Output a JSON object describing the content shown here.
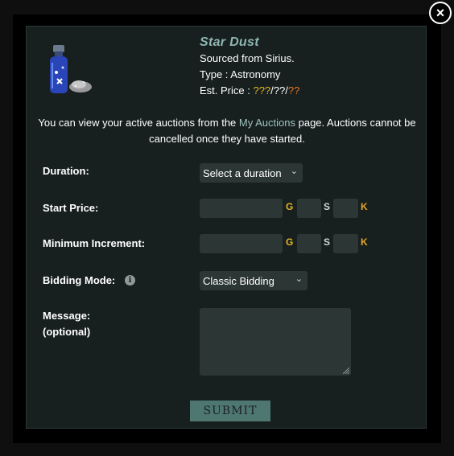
{
  "item": {
    "name": "Star Dust",
    "source": "Sourced from Sirius.",
    "type": "Type : Astronomy",
    "price_label": "Est. Price : ",
    "price_g": "???",
    "price_sep1": "/",
    "price_s": "??",
    "price_sep2": "/",
    "price_k": "??",
    "icon": "star-dust-vial-icon"
  },
  "notice": {
    "prefix": "You can view your active auctions from the ",
    "link": "My Auctions",
    "suffix": " page. Auctions cannot be cancelled once they have started."
  },
  "form": {
    "duration_label": "Duration:",
    "duration_value": "Select a duration",
    "start_price_label": "Start Price:",
    "min_increment_label": "Minimum Increment:",
    "bidding_mode_label": "Bidding Mode:",
    "bidding_mode_value": "Classic Bidding",
    "message_label": "Message:",
    "message_optional": "(optional)",
    "coin_g": "G",
    "coin_s": "S",
    "coin_k": "K"
  },
  "submit_label": "SUBMIT",
  "close_label": "×",
  "colors": {
    "panel_bg": "#17201f",
    "accent_teal": "#8fb6b2",
    "gold": "#e4b325",
    "submit_bg": "#4e7772"
  }
}
